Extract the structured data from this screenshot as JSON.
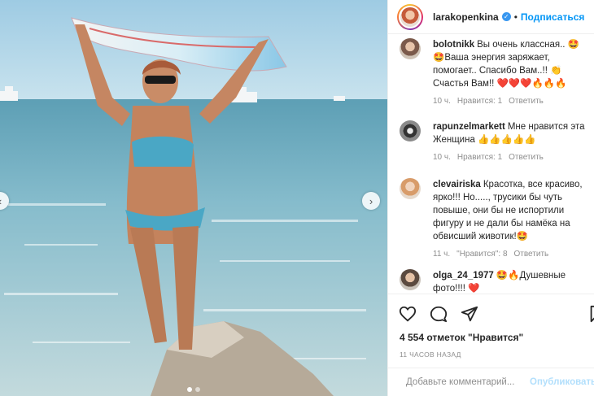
{
  "post": {
    "username": "larakopenkina",
    "follow_label": "Подписаться",
    "separator": "•",
    "verified_mark": "✓"
  },
  "photo": {
    "prev_arrow": "‹",
    "next_arrow": "›",
    "slide_count": 2,
    "active_slide": 1
  },
  "comments": [
    {
      "username": "bolotnikk",
      "text": "Вы очень классная.. 🤩 🤩Ваша энергия заряжает, помогает.. Спасибо Вам..!! 👏 Счастья Вам!! ❤️❤️❤️🔥🔥🔥",
      "time": "10 ч.",
      "likes": "Нравится: 1",
      "reply": "Ответить"
    },
    {
      "username": "rapunzelmarkett",
      "text": "Мне нравится эта Женщина 👍👍👍👍👍",
      "time": "10 ч.",
      "likes": "Нравится: 1",
      "reply": "Ответить"
    },
    {
      "username": "clevairiska",
      "text": "Красотка, все красиво, ярко!!! Но....., трусики бы чуть повыше, они бы не испортили фигуру и не дали бы намёка на обвисший животик!🤩",
      "time": "11 ч.",
      "likes": "\"Нравится\": 8",
      "reply": "Ответить"
    },
    {
      "username": "olga_24_1977",
      "text": "🤩🔥Душевные фото!!!! ❤️",
      "time": "",
      "likes": "",
      "reply": ""
    }
  ],
  "actions": {
    "likes_text": "4 554 отметок \"Нравится\"",
    "time_ago": "11 ЧАСОВ НАЗАД",
    "comment_placeholder": "Добавьте комментарий...",
    "publish_label": "Опубликовать"
  },
  "icons": {
    "like": "heart-icon",
    "comment": "comment-icon",
    "share": "share-icon",
    "save": "bookmark-icon",
    "emoji": "emoji-icon",
    "comment_like": "small-heart-icon"
  },
  "colors": {
    "accent": "#0095f6",
    "verified": "#3897f0",
    "publish_disabled": "#b2dffc",
    "muted": "#8e8e8e"
  }
}
